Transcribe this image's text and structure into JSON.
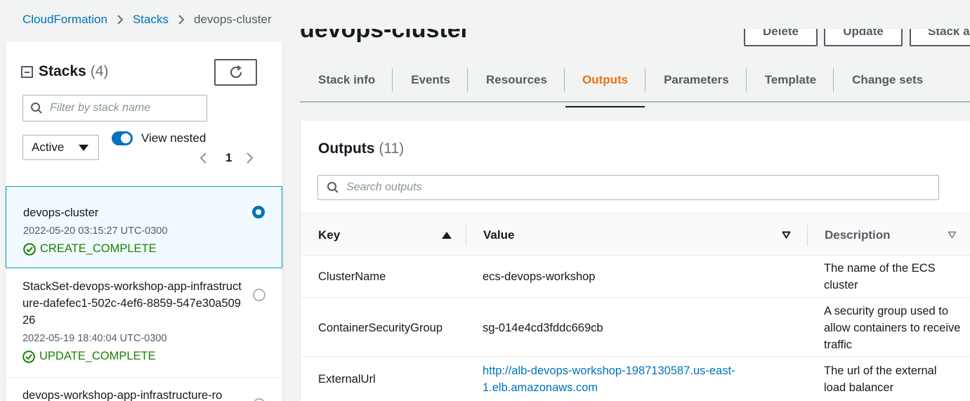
{
  "breadcrumb": {
    "items": [
      "CloudFormation",
      "Stacks"
    ],
    "current": "devops-cluster"
  },
  "sidebar": {
    "title": "Stacks",
    "count": "(4)",
    "filter_placeholder": "Filter by stack name",
    "status_filter": "Active",
    "view_nested_label": "View nested",
    "view_nested_on": true,
    "page": "1",
    "stacks": [
      {
        "name": "devops-cluster",
        "date": "2022-05-20 03:15:27 UTC-0300",
        "status": "CREATE_COMPLETE",
        "selected": true
      },
      {
        "name": "StackSet-devops-workshop-app-infrastructure-dafefec1-502c-4ef6-8859-547e30a50926",
        "date": "2022-05-19 18:40:04 UTC-0300",
        "status": "UPDATE_COMPLETE",
        "selected": false
      },
      {
        "name": "devops-workshop-app-infrastructure-ro",
        "date": "",
        "status": "",
        "selected": false
      }
    ]
  },
  "main": {
    "stack_title": "devops-cluster",
    "actions": [
      "Delete",
      "Update",
      "Stack a"
    ],
    "tabs": [
      "Stack info",
      "Events",
      "Resources",
      "Outputs",
      "Parameters",
      "Template",
      "Change sets"
    ],
    "active_tab": "Outputs",
    "outputs": {
      "title": "Outputs",
      "count": "(11)",
      "search_placeholder": "Search outputs",
      "columns": [
        "Key",
        "Value",
        "Description"
      ],
      "rows": [
        {
          "key": "ClusterName",
          "value": "ecs-devops-workshop",
          "value_is_link": false,
          "description": "The name of the ECS cluster"
        },
        {
          "key": "ContainerSecurityGroup",
          "value": "sg-014e4cd3fddc669cb",
          "value_is_link": false,
          "description": "A security group used to allow containers to receive traffic"
        },
        {
          "key": "ExternalUrl",
          "value": "http://alb-devops-workshop-1987130587.us-east-1.elb.amazonaws.com",
          "value_is_link": true,
          "description": "The url of the external load balancer"
        }
      ]
    }
  },
  "colors": {
    "link": "#0073bb",
    "active_tab": "#ec7211",
    "success": "#1d8102",
    "selected_bg": "#f1faff"
  },
  "icons": [
    "chevron-right-icon",
    "collapse-icon",
    "refresh-icon",
    "search-icon",
    "caret-down-icon",
    "chevron-left-icon",
    "success-check-icon",
    "sort-ascending-icon",
    "sort-descending-icon"
  ]
}
